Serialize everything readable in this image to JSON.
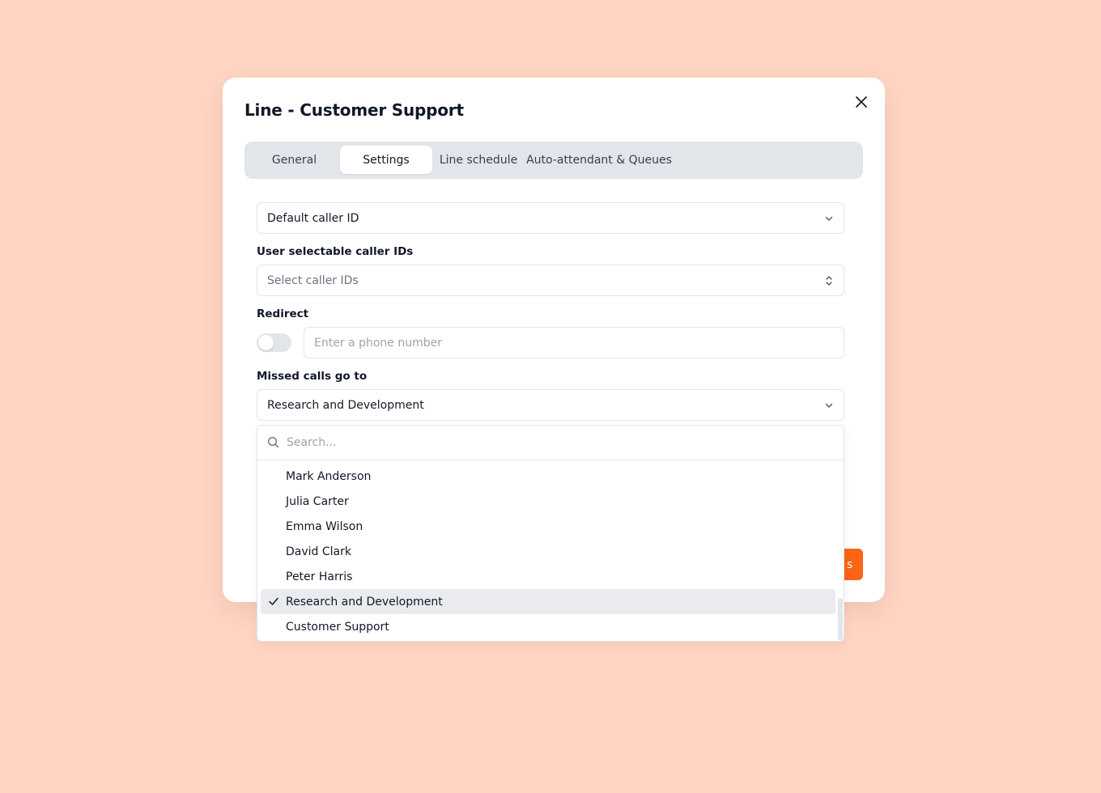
{
  "modal": {
    "title": "Line - Customer Support"
  },
  "tabs": [
    {
      "label": "General",
      "active": false
    },
    {
      "label": "Settings",
      "active": true
    },
    {
      "label": "Line schedule",
      "active": false
    },
    {
      "label": "Auto-attendant & Queues",
      "active": false
    }
  ],
  "default_caller_id": {
    "value": "Default caller ID"
  },
  "user_selectable_caller_ids": {
    "label": "User selectable caller IDs",
    "placeholder": "Select caller IDs"
  },
  "redirect": {
    "label": "Redirect",
    "enabled": false,
    "placeholder": "Enter a phone number"
  },
  "missed_calls": {
    "label": "Missed calls go to",
    "value": "Research and Development"
  },
  "dropdown": {
    "search_placeholder": "Search...",
    "options": [
      {
        "label": "Mark Anderson",
        "selected": false
      },
      {
        "label": "Julia Carter",
        "selected": false
      },
      {
        "label": "Emma Wilson",
        "selected": false
      },
      {
        "label": "David Clark",
        "selected": false
      },
      {
        "label": "Peter Harris",
        "selected": false
      },
      {
        "label": "Research and Development",
        "selected": true
      },
      {
        "label": "Customer Support",
        "selected": false
      }
    ]
  },
  "footer": {
    "save_label_visible": "s"
  },
  "colors": {
    "background": "#ffd4c2",
    "accent": "#fb6514",
    "tab_bar": "#e2e5ea",
    "selected_option": "#e9ebef"
  },
  "icons": {
    "close": "close-icon",
    "chevron": "chevron-down-icon",
    "updown": "chevron-up-down-icon",
    "search": "search-icon",
    "check": "check-icon"
  }
}
